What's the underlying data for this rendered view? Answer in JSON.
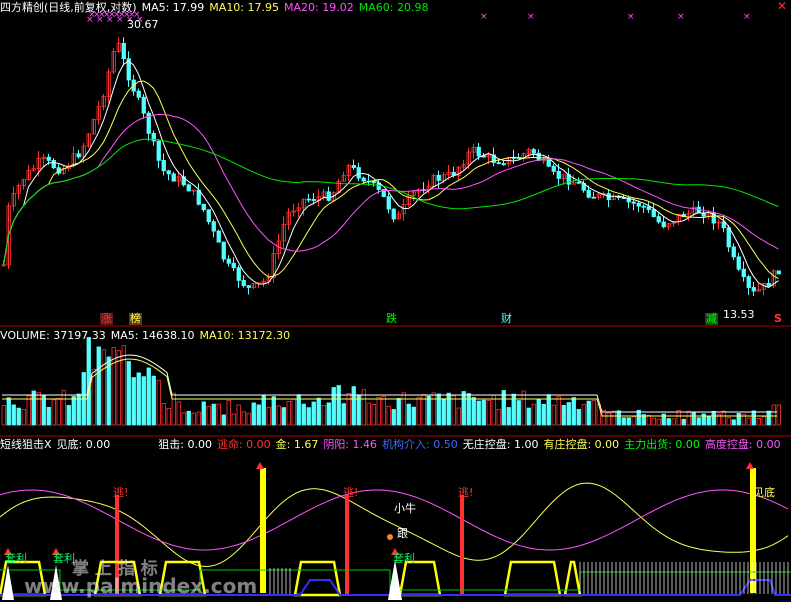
{
  "main_header": {
    "title": "四方精创(日线,前复权,对数)",
    "ma5": "MA5: 17.99",
    "ma10": "MA10: 17.95",
    "ma20": "MA20: 19.02",
    "ma60": "MA60: 20.98"
  },
  "main_labels": {
    "peak": "30.67",
    "low": "13.53",
    "zhang": "涨",
    "bang": "榜",
    "die": "跌",
    "cai": "财",
    "jian": "减",
    "s_marker": "S"
  },
  "volume_header": {
    "title": "VOLUME: 37197.33",
    "ma5": "MA5: 14638.10",
    "ma10": "MA10: 13172.30"
  },
  "indicator_header": {
    "name": "短线狙击X",
    "jiandi": "见底: 0.00",
    "juji": "狙击: 0.00",
    "taoming": "逃命: 0.00",
    "jin": "金: 1.67",
    "yinyang": "阴阳: 1.46",
    "jigou": "机构介入: 0.50",
    "wuzhuang": "无庄控盘: 1.00",
    "youzhuang": "有庄控盘: 0.00",
    "zhuli": "主力出货: 0.00",
    "gaodu": "高度控盘: 0.00"
  },
  "indicator_labels": {
    "tao1": "逃!",
    "tao2": "逃!",
    "tao3": "逃!",
    "xiaoniu": "小牛",
    "ganzhang": "跟",
    "jiandi_label": "见底",
    "taoli1": "套利",
    "taoli2": "套利",
    "taoli3": "套利"
  },
  "watermark": {
    "cn": "掌 上 指 标",
    "url": "www.palmindex.com"
  },
  "icons": {
    "close": "close-icon"
  },
  "colors": {
    "up": "#ff3232",
    "down": "#54ffff",
    "ma5": "#ffffff",
    "ma10": "#ffff54",
    "ma20": "#ff54ff",
    "ma60": "#00e600",
    "divider": "#b00000",
    "yellow_band": "#ffff00",
    "blue": "#3030ff"
  }
}
